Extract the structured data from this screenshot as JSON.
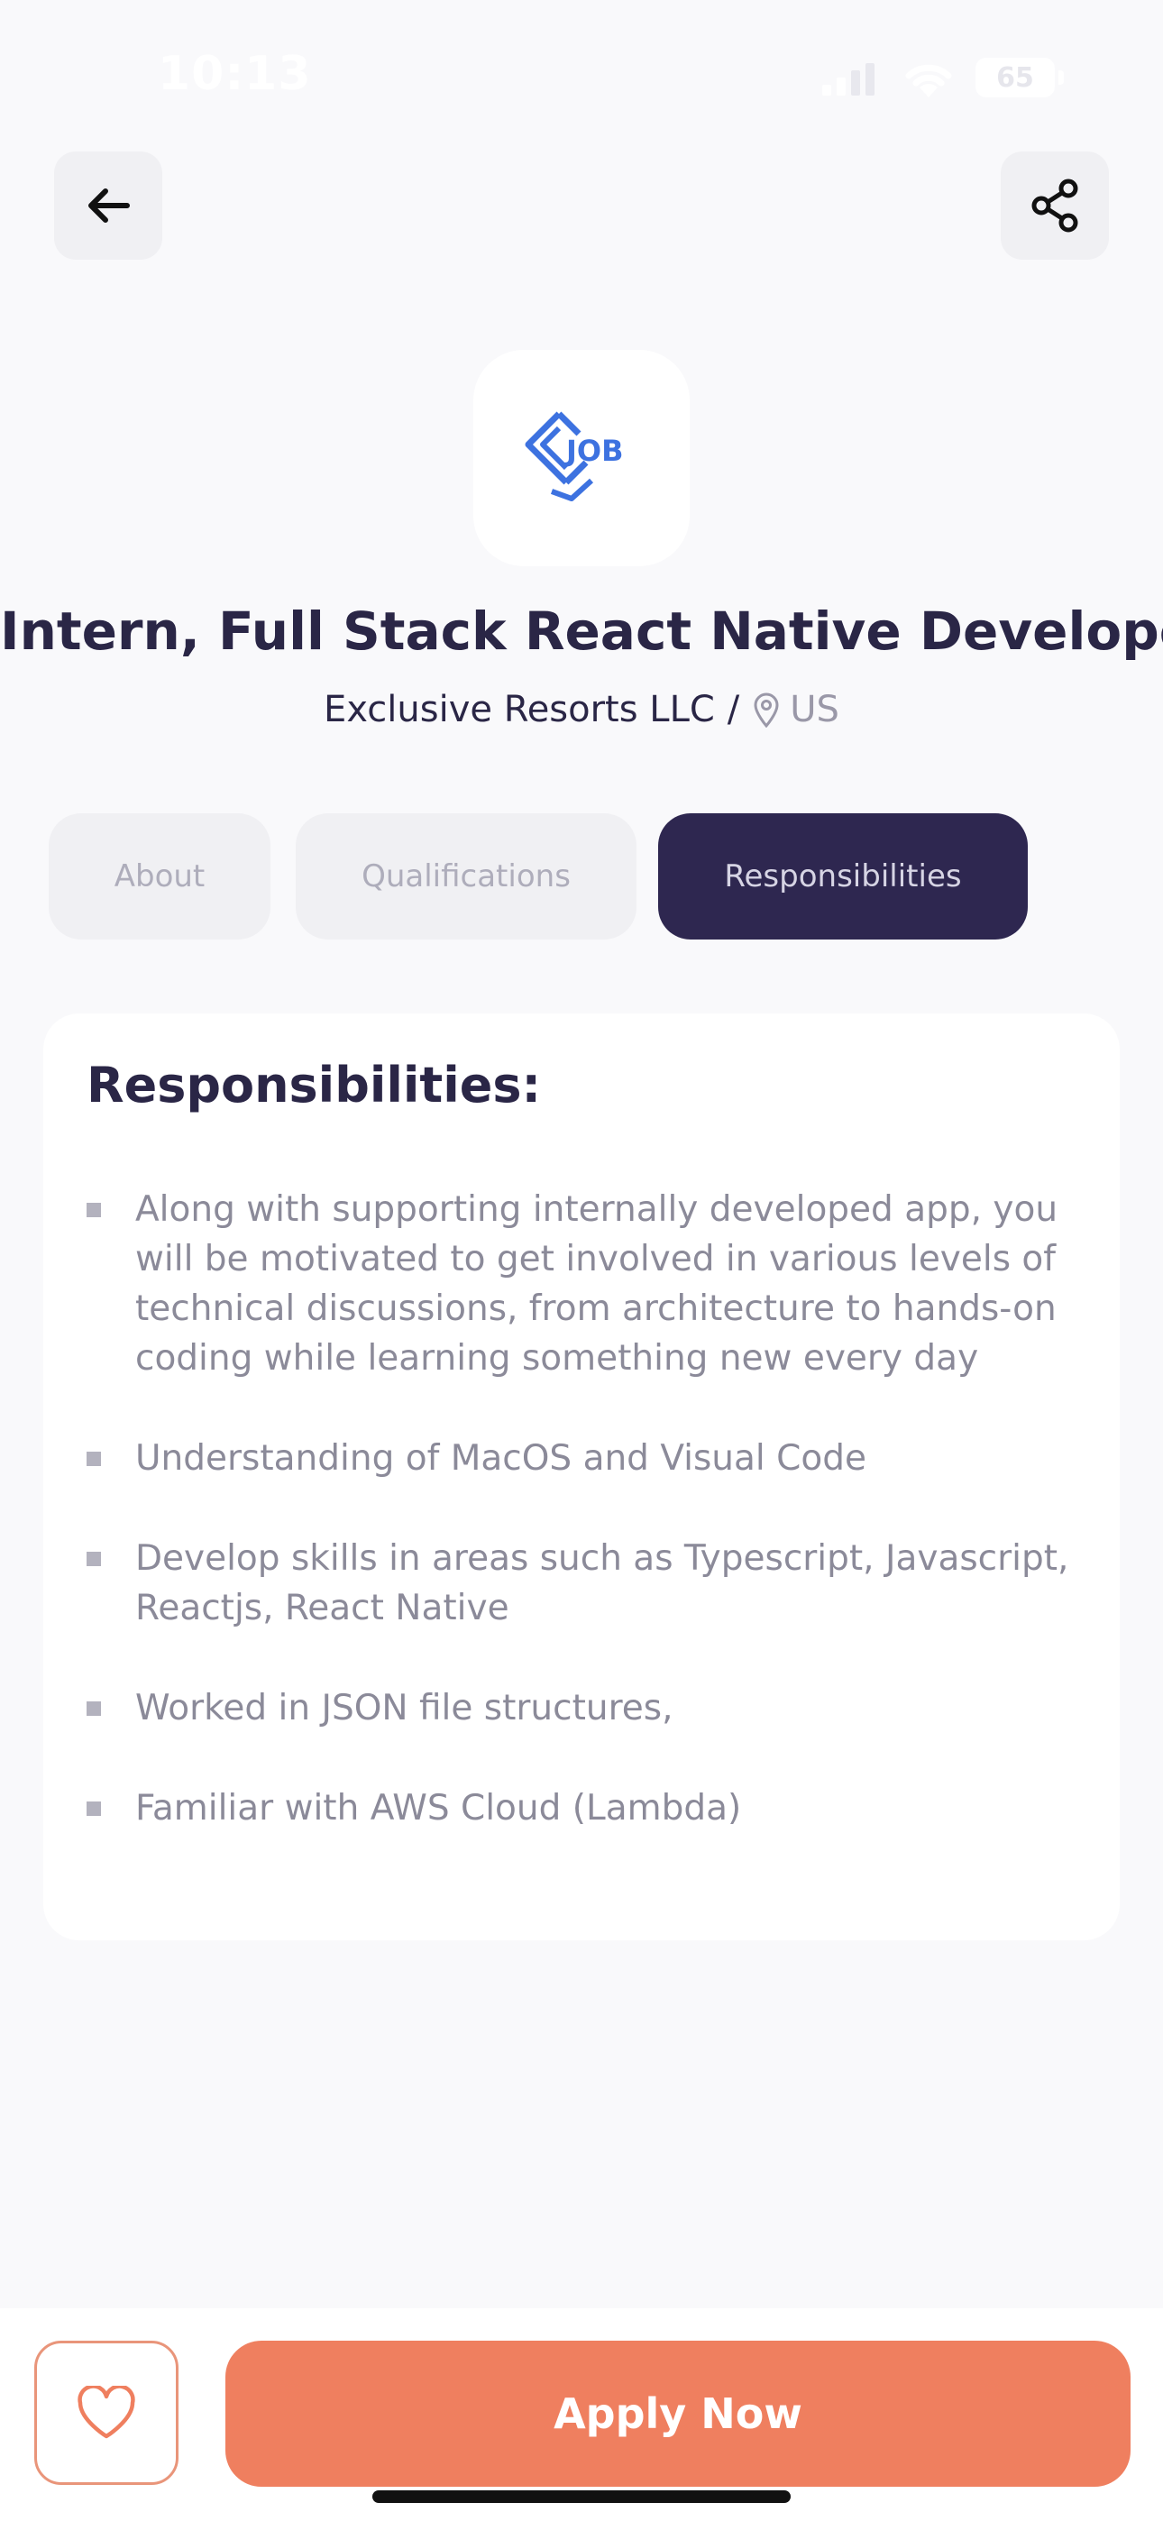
{
  "status_bar": {
    "time": "10:13",
    "battery": "65"
  },
  "header": {
    "back_icon": "arrow-left-icon",
    "share_icon": "share-icon"
  },
  "company": {
    "logo_text": "JOB",
    "logo_color": "#3D72E0",
    "name": "Exclusive Resorts LLC",
    "separator": "/",
    "location": "US"
  },
  "job": {
    "title": "Intern, Full Stack React Native Developer"
  },
  "tabs": [
    {
      "label": "About",
      "active": false
    },
    {
      "label": "Qualifications",
      "active": false
    },
    {
      "label": "Responsibilities",
      "active": true
    }
  ],
  "responsibilities": {
    "title": "Responsibilities:",
    "items": [
      "Along with supporting internally developed app, you will be motivated to get involved in various levels of technical discussions, from architecture to hands-on coding while learning something new every day",
      "Understanding of MacOS and Visual Code",
      "Develop skills in areas such as Typescript, Javascript, Reactjs, React Native",
      "Worked in JSON file structures,",
      "Familiar with AWS Cloud (Lambda)"
    ]
  },
  "footer": {
    "favorite_icon": "heart-icon",
    "apply_label": "Apply Now",
    "accent_color": "#EF7F5F"
  }
}
